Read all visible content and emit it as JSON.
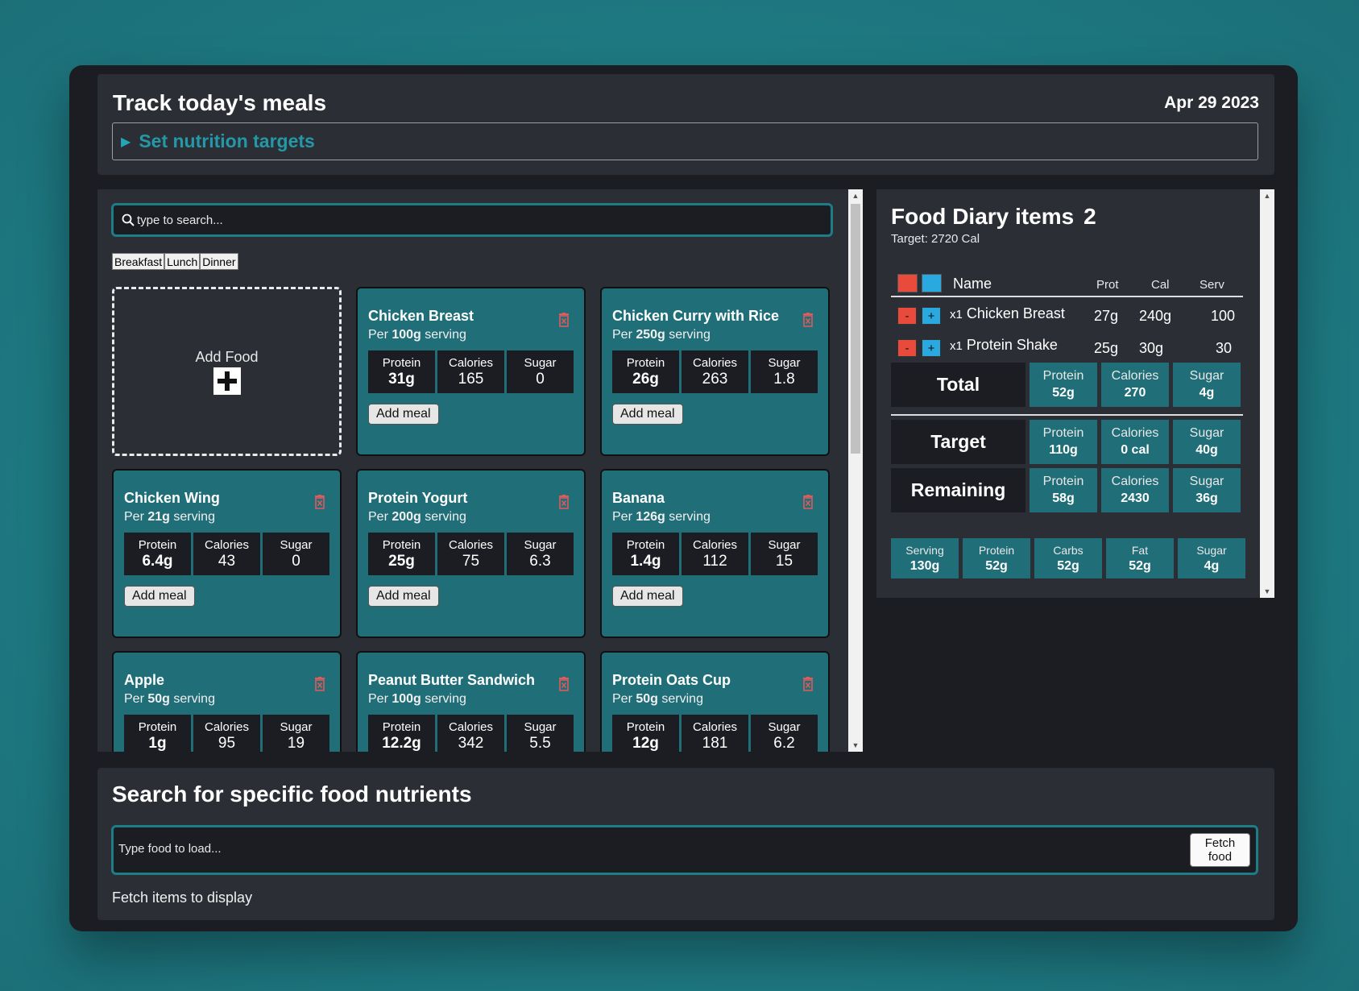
{
  "header": {
    "title": "Track today's meals",
    "date": "Apr 29 2023",
    "targets_toggle": "Set nutrition targets"
  },
  "foods": {
    "search_placeholder": "type to search...",
    "filters": [
      "Breakfast",
      "Lunch",
      "Dinner"
    ],
    "add_food_label": "Add Food",
    "add_meal_label": "Add meal",
    "cards": [
      {
        "name": "Chicken Breast",
        "per": "Per",
        "amount": "100g",
        "unit": "serving",
        "protein_label": "Protein",
        "protein": "31g",
        "calories_label": "Calories",
        "calories": "165",
        "sugar_label": "Sugar",
        "sugar": "0"
      },
      {
        "name": "Chicken Curry with Rice",
        "per": "Per",
        "amount": "250g",
        "unit": "serving",
        "protein_label": "Protein",
        "protein": "26g",
        "calories_label": "Calories",
        "calories": "263",
        "sugar_label": "Sugar",
        "sugar": "1.8"
      },
      {
        "name": "Chicken Wing",
        "per": "Per",
        "amount": "21g",
        "unit": "serving",
        "protein_label": "Protein",
        "protein": "6.4g",
        "calories_label": "Calories",
        "calories": "43",
        "sugar_label": "Sugar",
        "sugar": "0"
      },
      {
        "name": "Protein Yogurt",
        "per": "Per",
        "amount": "200g",
        "unit": "serving",
        "protein_label": "Protein",
        "protein": "25g",
        "calories_label": "Calories",
        "calories": "75",
        "sugar_label": "Sugar",
        "sugar": "6.3"
      },
      {
        "name": "Banana",
        "per": "Per",
        "amount": "126g",
        "unit": "serving",
        "protein_label": "Protein",
        "protein": "1.4g",
        "calories_label": "Calories",
        "calories": "112",
        "sugar_label": "Sugar",
        "sugar": "15"
      },
      {
        "name": "Apple",
        "per": "Per",
        "amount": "50g",
        "unit": "serving",
        "protein_label": "Protein",
        "protein": "1g",
        "calories_label": "Calories",
        "calories": "95",
        "sugar_label": "Sugar",
        "sugar": "19"
      },
      {
        "name": "Peanut Butter Sandwich",
        "per": "Per",
        "amount": "100g",
        "unit": "serving",
        "protein_label": "Protein",
        "protein": "12.2g",
        "calories_label": "Calories",
        "calories": "342",
        "sugar_label": "Sugar",
        "sugar": "5.5"
      },
      {
        "name": "Protein Oats Cup",
        "per": "Per",
        "amount": "50g",
        "unit": "serving",
        "protein_label": "Protein",
        "protein": "12g",
        "calories_label": "Calories",
        "calories": "181",
        "sugar_label": "Sugar",
        "sugar": "6.2"
      }
    ]
  },
  "diary": {
    "title": "Food Diary items",
    "count": "2",
    "target": "Target: 2720 Cal",
    "columns": {
      "name": "Name",
      "prot": "Prot",
      "cal": "Cal",
      "serv": "Serv"
    },
    "minus": "-",
    "plus": "+",
    "items": [
      {
        "qty": "x1",
        "name": "Chicken Breast",
        "prot": "27g",
        "cal": "240g",
        "serv": "100"
      },
      {
        "qty": "x1",
        "name": "Protein Shake",
        "prot": "25g",
        "cal": "30g",
        "serv": "30"
      }
    ],
    "total": {
      "label": "Total",
      "protein_label": "Protein",
      "protein": "52g",
      "calories_label": "Calories",
      "calories": "270",
      "sugar_label": "Sugar",
      "sugar": "4g"
    },
    "target_row": {
      "label": "Target",
      "protein_label": "Protein",
      "protein": "110g",
      "calories_label": "Calories",
      "calories": "0 cal",
      "sugar_label": "Sugar",
      "sugar": "40g"
    },
    "remaining": {
      "label": "Remaining",
      "protein_label": "Protein",
      "protein": "58g",
      "calories_label": "Calories",
      "calories": "2430",
      "sugar_label": "Sugar",
      "sugar": "36g"
    },
    "macros": [
      {
        "label": "Serving",
        "value": "130g"
      },
      {
        "label": "Protein",
        "value": "52g"
      },
      {
        "label": "Carbs",
        "value": "52g"
      },
      {
        "label": "Fat",
        "value": "52g"
      },
      {
        "label": "Sugar",
        "value": "4g"
      }
    ]
  },
  "nutrients": {
    "title": "Search for specific food nutrients",
    "placeholder": "Type food to load...",
    "fetch_line1": "Fetch",
    "fetch_line2": "food",
    "status": "Fetch items to display"
  },
  "colors": {
    "accent_teal": "#1f6e78",
    "link_teal": "#2498a6",
    "panel_bg": "#2c2e36",
    "dark_bg": "#1c1d22",
    "minus_red": "#e84a3b",
    "plus_blue": "#2aa9e0"
  },
  "icons": {
    "search": "search-icon",
    "trash": "trash-icon",
    "plus": "plus-icon",
    "toggle": "caret-right-icon"
  }
}
